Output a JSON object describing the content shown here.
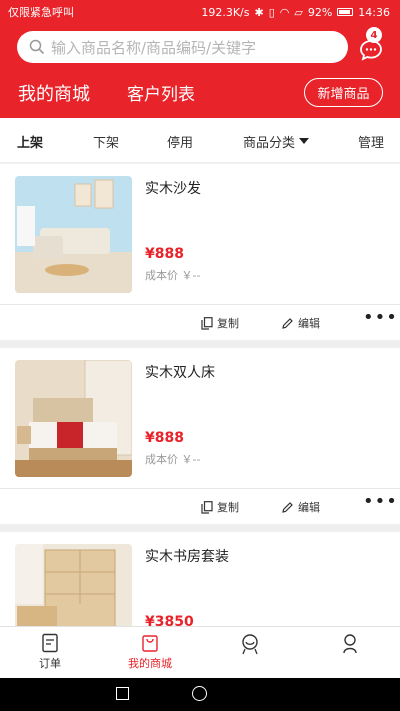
{
  "status_bar": {
    "left_text": "仅限紧急呼叫",
    "speed": "192.3K/s",
    "battery": "92%",
    "time": "14:36"
  },
  "search": {
    "placeholder": "输入商品名称/商品编码/关键字"
  },
  "messages": {
    "badge": "4",
    "icon": "chat-icon"
  },
  "header_tabs": [
    "我的商城",
    "客户列表"
  ],
  "add_button": "新增商品",
  "filters": [
    "上架",
    "下架",
    "停用",
    "商品分类",
    "管理"
  ],
  "products": [
    {
      "name": "实木沙发",
      "price": "¥888",
      "cost": "成本价 ￥--",
      "copy": "复制",
      "edit": "编辑"
    },
    {
      "name": "实木双人床",
      "price": "¥888",
      "cost": "成本价 ￥--",
      "copy": "复制",
      "edit": "编辑"
    },
    {
      "name": "实木书房套装",
      "price": "¥3850",
      "cost": "",
      "copy": "",
      "edit": ""
    }
  ],
  "bottom_nav": [
    {
      "label": "订单",
      "icon": "order-icon",
      "active": false
    },
    {
      "label": "我的商城",
      "icon": "shop-bag-icon",
      "active": true
    },
    {
      "label": "",
      "icon": "service-icon",
      "active": false
    },
    {
      "label": "",
      "icon": "user-icon",
      "active": false
    }
  ],
  "colors": {
    "accent": "#e8232a"
  }
}
